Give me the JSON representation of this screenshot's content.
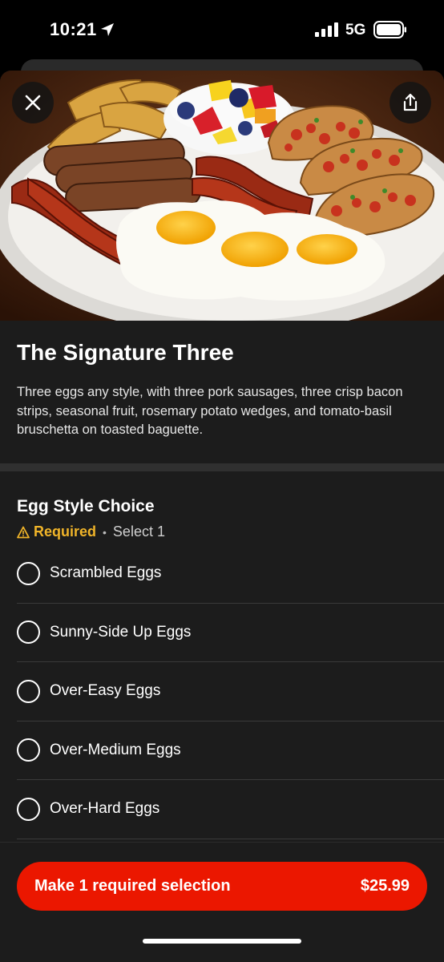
{
  "status_bar": {
    "time": "10:21",
    "network": "5G",
    "icons": [
      "location-arrow-icon",
      "signal-bars-icon",
      "battery-icon"
    ]
  },
  "hero": {
    "image_description": "Breakfast plate with eggs, sausages, bacon, potato wedges, fruit cup and bruschetta",
    "close_icon": "close-icon",
    "share_icon": "share-icon"
  },
  "item": {
    "title": "The Signature Three",
    "description": "Three eggs any style, with three pork sausages, three crisp bacon strips, seasonal fruit, rosemary potato wedges, and tomato-basil bruschetta on toasted baguette."
  },
  "option_group": {
    "title": "Egg Style Choice",
    "required_label": "Required",
    "separator": "•",
    "select_count": "Select 1",
    "warning_icon": "warning-triangle-icon",
    "options": [
      {
        "label": "Scrambled Eggs",
        "selected": false
      },
      {
        "label": "Sunny-Side Up Eggs",
        "selected": false
      },
      {
        "label": "Over-Easy Eggs",
        "selected": false
      },
      {
        "label": "Over-Medium Eggs",
        "selected": false
      },
      {
        "label": "Over-Hard Eggs",
        "selected": false
      }
    ]
  },
  "footer": {
    "cta_label": "Make 1 required selection",
    "price": "$25.99"
  },
  "colors": {
    "background": "#1c1c1c",
    "accent": "#eb1700",
    "required": "#f0b429"
  }
}
